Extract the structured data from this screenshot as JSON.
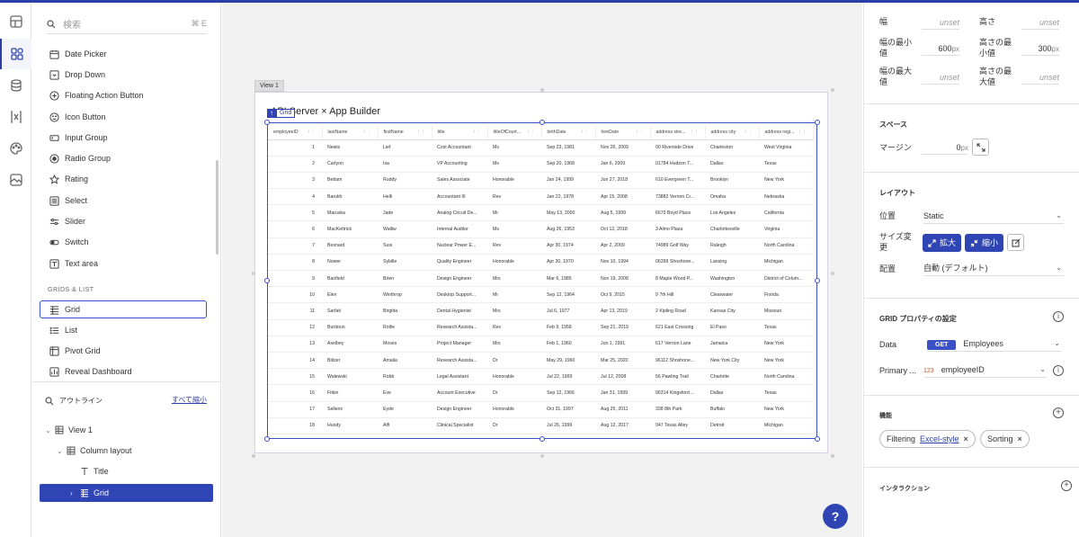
{
  "search": {
    "placeholder": "検索",
    "shortcut": "⌘ E"
  },
  "components": [
    {
      "label": "Date Picker",
      "icon": "calendar-icon"
    },
    {
      "label": "Drop Down",
      "icon": "dropdown-icon"
    },
    {
      "label": "Floating Action Button",
      "icon": "plus-circle-icon"
    },
    {
      "label": "Icon Button",
      "icon": "smiley-icon"
    },
    {
      "label": "Input Group",
      "icon": "input-icon"
    },
    {
      "label": "Radio Group",
      "icon": "radio-icon"
    },
    {
      "label": "Rating",
      "icon": "star-icon"
    },
    {
      "label": "Select",
      "icon": "select-icon"
    },
    {
      "label": "Slider",
      "icon": "slider-icon"
    },
    {
      "label": "Switch",
      "icon": "switch-icon"
    },
    {
      "label": "Text area",
      "icon": "textarea-icon"
    }
  ],
  "section_grids": "GRIDS & LIST",
  "grid_components": [
    {
      "label": "Grid",
      "icon": "grid-icon"
    },
    {
      "label": "List",
      "icon": "list-icon"
    },
    {
      "label": "Pivot Grid",
      "icon": "pivot-icon"
    },
    {
      "label": "Reveal Dashboard",
      "icon": "dashboard-icon"
    }
  ],
  "outline": {
    "title": "アウトライン",
    "collapse_all": "すべて縮小",
    "items": [
      {
        "label": "View 1"
      },
      {
        "label": "Column layout"
      },
      {
        "label": "Title"
      },
      {
        "label": "Grid"
      }
    ]
  },
  "canvas": {
    "view_tab": "View 1",
    "title": "API Server × App Builder",
    "grid_tag": "Grid",
    "help": "?"
  },
  "grid": {
    "columns": [
      "employeeID",
      "lastName",
      "firstName",
      "title",
      "titleOfCourt...",
      "birthDate",
      "hireDate",
      "address stre...",
      "address city",
      "address regi..."
    ],
    "rows": [
      [
        "1",
        "Newis",
        "Lief",
        "Cost Accountant",
        "Ms",
        "Sep 23, 1981",
        "Nov 26, 2009",
        "00 Riverside Drive",
        "Charleston",
        "West Virginia"
      ],
      [
        "2",
        "Carlyon",
        "Isa",
        "VP Accounting",
        "Ms",
        "Sep 20, 1968",
        "Jan 6, 2009",
        "01784 Hudson T...",
        "Dallas",
        "Texas"
      ],
      [
        "3",
        "Bettam",
        "Ruddy",
        "Sales Associate",
        "Honorable",
        "Jan 24, 1999",
        "Jun 27, 2018",
        "610 Evergreen T...",
        "Brooklyn",
        "New York"
      ],
      [
        "4",
        "Barukh",
        "Helli",
        "Accountant III",
        "Rev",
        "Jan 22, 1978",
        "Apr 15, 2008",
        "73882 Vernon Cr...",
        "Omaha",
        "Nebraska"
      ],
      [
        "5",
        "Maruska",
        "Jade",
        "Analog Circuit De...",
        "Mr",
        "May 13, 2000",
        "Aug 5, 1999",
        "6670 Boyd Place",
        "Los Angeles",
        "California"
      ],
      [
        "6",
        "MacKettrick",
        "Walliw",
        "Internal Auditor",
        "Ms",
        "Aug 26, 1953",
        "Oct 12, 2018",
        "3 Almo Plaza",
        "Charlottesville",
        "Virginia"
      ],
      [
        "7",
        "Besnard",
        "Susi",
        "Nuclear Power E...",
        "Rev",
        "Apr 30, 1974",
        "Apr 2, 2009",
        "74989 Golf Way",
        "Raleigh",
        "North Carolina"
      ],
      [
        "8",
        "Nower",
        "Sybille",
        "Quality Engineer",
        "Honorable",
        "Apr 30, 1970",
        "Nov 10, 1994",
        "06399 Shoshone...",
        "Lansing",
        "Michigan"
      ],
      [
        "9",
        "Banfield",
        "Brien",
        "Design Engineer",
        "Mrs",
        "Mar 6, 1985",
        "Nov 19, 2008",
        "8 Maple Wood P...",
        "Washington",
        "District of Colum..."
      ],
      [
        "10",
        "Elen",
        "Winthrop",
        "Desktop Support...",
        "Mr",
        "Sep 12, 1964",
        "Oct 9, 2015",
        "9 7th Hill",
        "Clearwater",
        "Florida"
      ],
      [
        "11",
        "Sarfati",
        "Birgitta",
        "Dental Hygienist",
        "Mrs",
        "Jul 6, 1977",
        "Apr 13, 2019",
        "2 Kipling Road",
        "Kansas City",
        "Missouri"
      ],
      [
        "12",
        "Burdoun",
        "Rollie",
        "Research Assista...",
        "Rev",
        "Feb 9, 1958",
        "Sep 21, 2019",
        "621 East Crossing",
        "El Paso",
        "Texas"
      ],
      [
        "13",
        "Axelbey",
        "Moses",
        "Project Manager",
        "Mrs",
        "Feb 1, 1960",
        "Jun 1, 1991",
        "617 Vernon Lane",
        "Jamaica",
        "New York"
      ],
      [
        "14",
        "Blitzer",
        "Amalia",
        "Research Assista...",
        "Dr",
        "May 29, 1960",
        "Mar 25, 2020",
        "96112 Shoshone...",
        "New York City",
        "New York"
      ],
      [
        "15",
        "Walewski",
        "Robb",
        "Legal Assistant",
        "Honorable",
        "Jul 22, 1969",
        "Jul 12, 2008",
        "56 Pawling Trail",
        "Charlotte",
        "North Carolina"
      ],
      [
        "16",
        "Fitkin",
        "Eve",
        "Account Executive",
        "Dr",
        "Sep 12, 1966",
        "Jan 31, 1999",
        "96314 Kingsford ...",
        "Dallas",
        "Texas"
      ],
      [
        "17",
        "Sellens",
        "Eyde",
        "Design Engineer",
        "Honorable",
        "Oct 31, 1997",
        "Aug 25, 2011",
        "338 8th Park",
        "Buffalo",
        "New York"
      ],
      [
        "18",
        "Hundy",
        "Alfi",
        "Clinical Specialist",
        "Dr",
        "Jul 26, 1999",
        "Aug 12, 2017",
        "047 Texas Alley",
        "Detroit",
        "Michigan"
      ]
    ]
  },
  "props": {
    "width_label": "幅",
    "width_value": "unset",
    "height_label": "高さ",
    "height_value": "unset",
    "min_width_label": "幅の最小値",
    "min_width_value": "600",
    "min_width_unit": "px",
    "min_height_label": "高さの最小値",
    "min_height_value": "300",
    "min_height_unit": "px",
    "max_width_label": "幅の最大値",
    "max_width_value": "unset",
    "max_height_label": "高さの最大値",
    "max_height_value": "unset",
    "space_title": "スペース",
    "margin_label": "マージン",
    "margin_value": "0",
    "margin_unit": "px",
    "layout_title": "レイアウト",
    "position_label": "位置",
    "position_value": "Static",
    "resize_label": "サイズ変更",
    "expand_label": "拡大",
    "shrink_label": "縮小",
    "align_label": "配置",
    "align_value": "自動 (デフォルト)",
    "grid_props_title": "GRID プロパティの設定",
    "data_label": "Data",
    "data_method": "GET",
    "data_value": "Employees",
    "primary_label": "Primary ...",
    "primary_type": "123",
    "primary_value": "employeeID",
    "features_title": "機能",
    "chip_filtering": "Filtering",
    "chip_filtering_link": "Excel-style",
    "chip_sorting": "Sorting",
    "interaction_title": "インタラクション"
  },
  "colors": {
    "accent": "#2f45b3",
    "topbar": "#2c3fa8"
  }
}
